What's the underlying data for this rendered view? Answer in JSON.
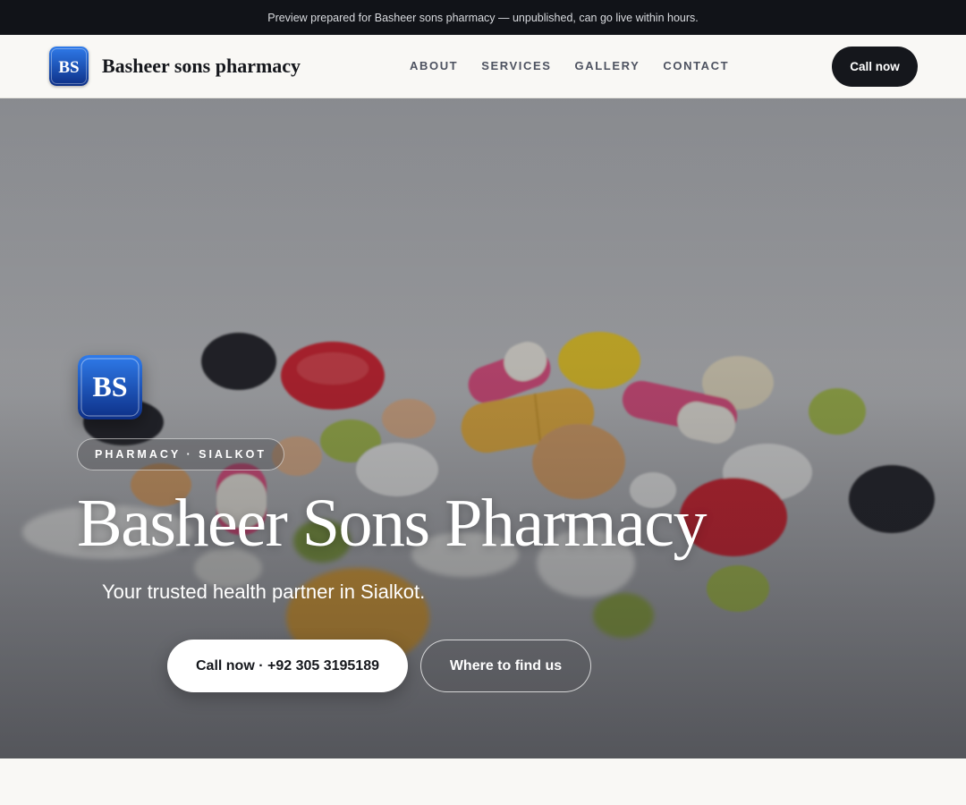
{
  "announcement": "Preview prepared for Basheer sons pharmacy — unpublished, can go live within hours.",
  "brand": {
    "logo_text": "BS",
    "name": "Basheer sons pharmacy"
  },
  "nav": {
    "links": [
      "ABOUT",
      "SERVICES",
      "GALLERY",
      "CONTACT"
    ],
    "cta_label": "Call now"
  },
  "hero": {
    "logo_text": "BS",
    "kicker": "PHARMACY · SIALKOT",
    "title": "Basheer Sons Pharmacy",
    "subtitle": "Your trusted health partner in Sialkot.",
    "primary_button": "Call now · +92 305 3195189",
    "secondary_button": "Where to find us"
  },
  "colors": {
    "topbar_bg": "#111318",
    "page_bg": "#f9f8f5",
    "logo_blue": "#1a55c4",
    "dark_button": "#15171c"
  }
}
